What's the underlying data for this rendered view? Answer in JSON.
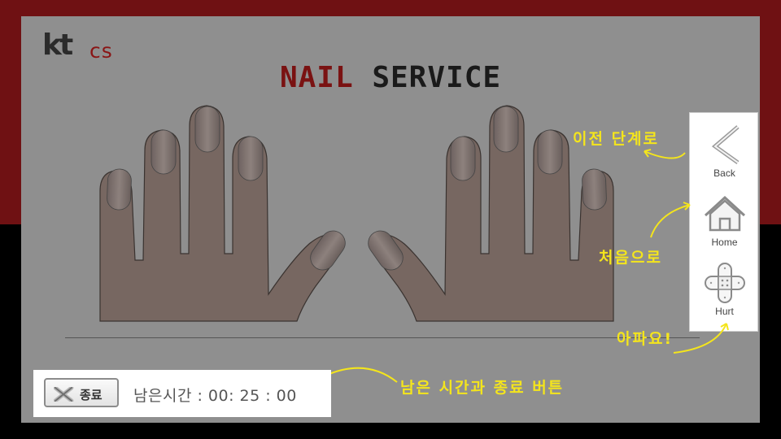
{
  "brand": {
    "logo_kt": "kt",
    "logo_cs": "cs"
  },
  "title": {
    "part1": "NAIL",
    "part2": " SERVICE"
  },
  "sidebar": {
    "items": [
      {
        "label": "Back",
        "icon": "chevron-left-icon"
      },
      {
        "label": "Home",
        "icon": "house-icon"
      },
      {
        "label": "Hurt",
        "icon": "bandage-icon"
      }
    ]
  },
  "annotations": {
    "back_note": "이전 단계로",
    "home_note": "처음으로",
    "hurt_note": "아파요!",
    "footer_note": "남은 시간과 종료 버튼"
  },
  "footer": {
    "end_label": "종료",
    "end_icon": "close-x-icon",
    "timer_text": "남은시간 : 00: 25 : 00"
  },
  "colors": {
    "brand_red": "#7a1212",
    "annotation_yellow": "#f4e51c",
    "panel_gray": "#8f8f8f",
    "skin": "#7a6a63"
  }
}
